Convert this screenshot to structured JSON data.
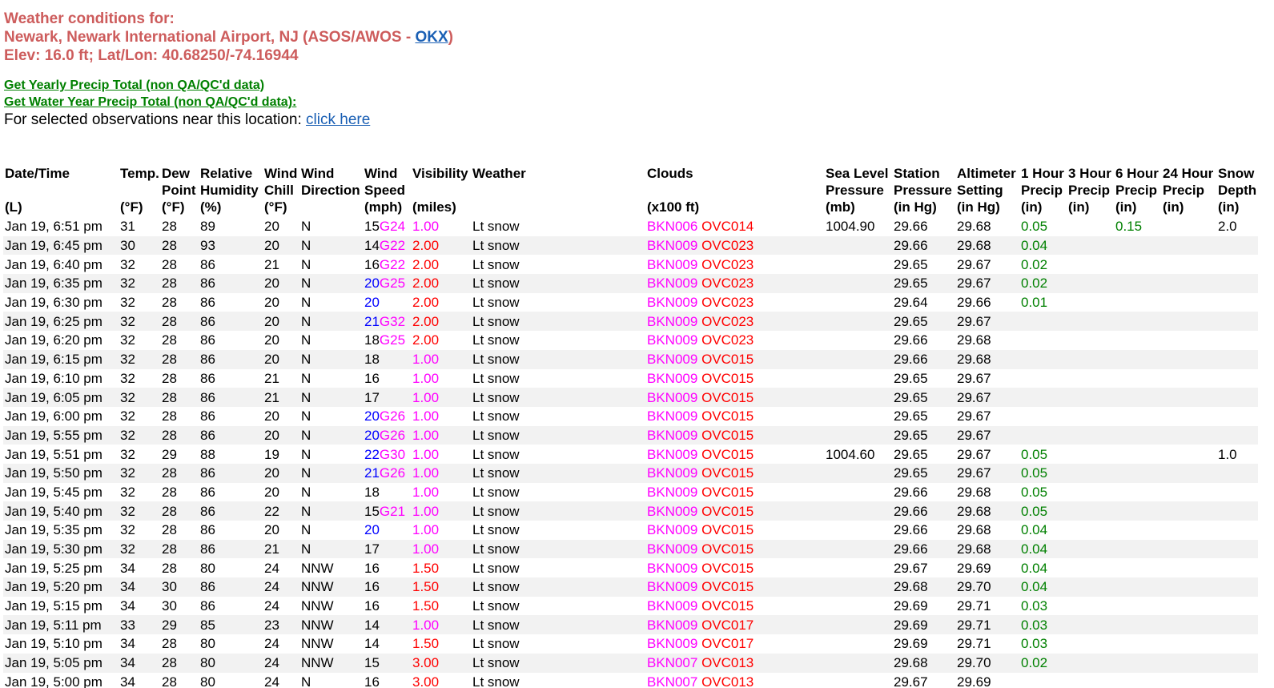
{
  "header": {
    "line1": "Weather conditions for:",
    "line2_prefix": "Newark, Newark International Airport, NJ (ASOS/AWOS - ",
    "line2_link": "OKX",
    "line2_suffix": ")",
    "line3": "Elev: 16.0 ft; Lat/Lon: 40.68250/-74.16944"
  },
  "links": {
    "yearly_precip": "Get Yearly Precip Total (non QA/QC'd data)",
    "water_year_precip": "Get Water Year Precip Total (non QA/QC'd data):",
    "selected_obs_text": "For selected observations near this location: ",
    "click_here": "click here"
  },
  "table": {
    "headers": {
      "datetime": [
        "Date/Time",
        "",
        "(L)"
      ],
      "temp": [
        "Temp.",
        "",
        "(°F)"
      ],
      "dew": [
        "Dew",
        "Point",
        "(°F)"
      ],
      "rh": [
        "Relative",
        "Humidity",
        "(%)"
      ],
      "chill": [
        "Wind",
        "Chill",
        "(°F)"
      ],
      "wdir": [
        "Wind",
        "Direction",
        ""
      ],
      "wspd": [
        "Wind",
        "Speed",
        "(mph)"
      ],
      "vis": [
        "Visibility",
        "",
        "(miles)"
      ],
      "wx": [
        "Weather",
        "",
        ""
      ],
      "clouds": [
        "Clouds",
        "",
        "(x100 ft)"
      ],
      "slp": [
        "Sea Level",
        "Pressure",
        "(mb)"
      ],
      "stp": [
        "Station",
        "Pressure",
        "(in Hg)"
      ],
      "alt": [
        "Altimeter",
        "Setting",
        "(in Hg)"
      ],
      "p1": [
        "1 Hour",
        "Precip",
        "(in)"
      ],
      "p3": [
        "3 Hour",
        "Precip",
        "(in)"
      ],
      "p6": [
        "6 Hour",
        "Precip",
        "(in)"
      ],
      "p24": [
        "24 Hour",
        "Precip",
        "(in)"
      ],
      "snow": [
        "Snow",
        "Depth",
        "(in)"
      ]
    },
    "rows": [
      {
        "dt": "Jan 19, 6:51 pm",
        "t": "31",
        "dp": "28",
        "rh": "89",
        "wc": "20",
        "wd": "N",
        "ws": "15",
        "wg": "G24",
        "wsblue": false,
        "vis": "1.00",
        "visc": "mag",
        "wx": "Lt snow",
        "bkn": "BKN006",
        "ovc": "OVC014",
        "slp": "1004.90",
        "stp": "29.66",
        "alt": "29.68",
        "p1": "0.05",
        "p3": "",
        "p6": "0.15",
        "p24": "",
        "sd": "2.0"
      },
      {
        "dt": "Jan 19, 6:45 pm",
        "t": "30",
        "dp": "28",
        "rh": "93",
        "wc": "20",
        "wd": "N",
        "ws": "14",
        "wg": "G22",
        "wsblue": false,
        "vis": "2.00",
        "visc": "red",
        "wx": "Lt snow",
        "bkn": "BKN009",
        "ovc": "OVC023",
        "slp": "",
        "stp": "29.66",
        "alt": "29.68",
        "p1": "0.04",
        "p3": "",
        "p6": "",
        "p24": "",
        "sd": ""
      },
      {
        "dt": "Jan 19, 6:40 pm",
        "t": "32",
        "dp": "28",
        "rh": "86",
        "wc": "21",
        "wd": "N",
        "ws": "16",
        "wg": "G22",
        "wsblue": false,
        "vis": "2.00",
        "visc": "red",
        "wx": "Lt snow",
        "bkn": "BKN009",
        "ovc": "OVC023",
        "slp": "",
        "stp": "29.65",
        "alt": "29.67",
        "p1": "0.02",
        "p3": "",
        "p6": "",
        "p24": "",
        "sd": ""
      },
      {
        "dt": "Jan 19, 6:35 pm",
        "t": "32",
        "dp": "28",
        "rh": "86",
        "wc": "20",
        "wd": "N",
        "ws": "20",
        "wg": "G25",
        "wsblue": true,
        "vis": "2.00",
        "visc": "red",
        "wx": "Lt snow",
        "bkn": "BKN009",
        "ovc": "OVC023",
        "slp": "",
        "stp": "29.65",
        "alt": "29.67",
        "p1": "0.02",
        "p3": "",
        "p6": "",
        "p24": "",
        "sd": ""
      },
      {
        "dt": "Jan 19, 6:30 pm",
        "t": "32",
        "dp": "28",
        "rh": "86",
        "wc": "20",
        "wd": "N",
        "ws": "20",
        "wg": "",
        "wsblue": true,
        "vis": "2.00",
        "visc": "red",
        "wx": "Lt snow",
        "bkn": "BKN009",
        "ovc": "OVC023",
        "slp": "",
        "stp": "29.64",
        "alt": "29.66",
        "p1": "0.01",
        "p3": "",
        "p6": "",
        "p24": "",
        "sd": ""
      },
      {
        "dt": "Jan 19, 6:25 pm",
        "t": "32",
        "dp": "28",
        "rh": "86",
        "wc": "20",
        "wd": "N",
        "ws": "21",
        "wg": "G32",
        "wsblue": true,
        "vis": "2.00",
        "visc": "red",
        "wx": "Lt snow",
        "bkn": "BKN009",
        "ovc": "OVC023",
        "slp": "",
        "stp": "29.65",
        "alt": "29.67",
        "p1": "",
        "p3": "",
        "p6": "",
        "p24": "",
        "sd": ""
      },
      {
        "dt": "Jan 19, 6:20 pm",
        "t": "32",
        "dp": "28",
        "rh": "86",
        "wc": "20",
        "wd": "N",
        "ws": "18",
        "wg": "G25",
        "wsblue": false,
        "vis": "2.00",
        "visc": "red",
        "wx": "Lt snow",
        "bkn": "BKN009",
        "ovc": "OVC023",
        "slp": "",
        "stp": "29.66",
        "alt": "29.68",
        "p1": "",
        "p3": "",
        "p6": "",
        "p24": "",
        "sd": ""
      },
      {
        "dt": "Jan 19, 6:15 pm",
        "t": "32",
        "dp": "28",
        "rh": "86",
        "wc": "20",
        "wd": "N",
        "ws": "18",
        "wg": "",
        "wsblue": false,
        "vis": "1.00",
        "visc": "mag",
        "wx": "Lt snow",
        "bkn": "BKN009",
        "ovc": "OVC015",
        "slp": "",
        "stp": "29.66",
        "alt": "29.68",
        "p1": "",
        "p3": "",
        "p6": "",
        "p24": "",
        "sd": ""
      },
      {
        "dt": "Jan 19, 6:10 pm",
        "t": "32",
        "dp": "28",
        "rh": "86",
        "wc": "21",
        "wd": "N",
        "ws": "16",
        "wg": "",
        "wsblue": false,
        "vis": "1.00",
        "visc": "mag",
        "wx": "Lt snow",
        "bkn": "BKN009",
        "ovc": "OVC015",
        "slp": "",
        "stp": "29.65",
        "alt": "29.67",
        "p1": "",
        "p3": "",
        "p6": "",
        "p24": "",
        "sd": ""
      },
      {
        "dt": "Jan 19, 6:05 pm",
        "t": "32",
        "dp": "28",
        "rh": "86",
        "wc": "21",
        "wd": "N",
        "ws": "17",
        "wg": "",
        "wsblue": false,
        "vis": "1.00",
        "visc": "mag",
        "wx": "Lt snow",
        "bkn": "BKN009",
        "ovc": "OVC015",
        "slp": "",
        "stp": "29.65",
        "alt": "29.67",
        "p1": "",
        "p3": "",
        "p6": "",
        "p24": "",
        "sd": ""
      },
      {
        "dt": "Jan 19, 6:00 pm",
        "t": "32",
        "dp": "28",
        "rh": "86",
        "wc": "20",
        "wd": "N",
        "ws": "20",
        "wg": "G26",
        "wsblue": true,
        "vis": "1.00",
        "visc": "mag",
        "wx": "Lt snow",
        "bkn": "BKN009",
        "ovc": "OVC015",
        "slp": "",
        "stp": "29.65",
        "alt": "29.67",
        "p1": "",
        "p3": "",
        "p6": "",
        "p24": "",
        "sd": ""
      },
      {
        "dt": "Jan 19, 5:55 pm",
        "t": "32",
        "dp": "28",
        "rh": "86",
        "wc": "20",
        "wd": "N",
        "ws": "20",
        "wg": "G26",
        "wsblue": true,
        "vis": "1.00",
        "visc": "mag",
        "wx": "Lt snow",
        "bkn": "BKN009",
        "ovc": "OVC015",
        "slp": "",
        "stp": "29.65",
        "alt": "29.67",
        "p1": "",
        "p3": "",
        "p6": "",
        "p24": "",
        "sd": ""
      },
      {
        "dt": "Jan 19, 5:51 pm",
        "t": "32",
        "dp": "29",
        "rh": "88",
        "wc": "19",
        "wd": "N",
        "ws": "22",
        "wg": "G30",
        "wsblue": true,
        "vis": "1.00",
        "visc": "mag",
        "wx": "Lt snow",
        "bkn": "BKN009",
        "ovc": "OVC015",
        "slp": "1004.60",
        "stp": "29.65",
        "alt": "29.67",
        "p1": "0.05",
        "p3": "",
        "p6": "",
        "p24": "",
        "sd": "1.0"
      },
      {
        "dt": "Jan 19, 5:50 pm",
        "t": "32",
        "dp": "28",
        "rh": "86",
        "wc": "20",
        "wd": "N",
        "ws": "21",
        "wg": "G26",
        "wsblue": true,
        "vis": "1.00",
        "visc": "mag",
        "wx": "Lt snow",
        "bkn": "BKN009",
        "ovc": "OVC015",
        "slp": "",
        "stp": "29.65",
        "alt": "29.67",
        "p1": "0.05",
        "p3": "",
        "p6": "",
        "p24": "",
        "sd": ""
      },
      {
        "dt": "Jan 19, 5:45 pm",
        "t": "32",
        "dp": "28",
        "rh": "86",
        "wc": "20",
        "wd": "N",
        "ws": "18",
        "wg": "",
        "wsblue": false,
        "vis": "1.00",
        "visc": "mag",
        "wx": "Lt snow",
        "bkn": "BKN009",
        "ovc": "OVC015",
        "slp": "",
        "stp": "29.66",
        "alt": "29.68",
        "p1": "0.05",
        "p3": "",
        "p6": "",
        "p24": "",
        "sd": ""
      },
      {
        "dt": "Jan 19, 5:40 pm",
        "t": "32",
        "dp": "28",
        "rh": "86",
        "wc": "22",
        "wd": "N",
        "ws": "15",
        "wg": "G21",
        "wsblue": false,
        "vis": "1.00",
        "visc": "mag",
        "wx": "Lt snow",
        "bkn": "BKN009",
        "ovc": "OVC015",
        "slp": "",
        "stp": "29.66",
        "alt": "29.68",
        "p1": "0.05",
        "p3": "",
        "p6": "",
        "p24": "",
        "sd": ""
      },
      {
        "dt": "Jan 19, 5:35 pm",
        "t": "32",
        "dp": "28",
        "rh": "86",
        "wc": "20",
        "wd": "N",
        "ws": "20",
        "wg": "",
        "wsblue": true,
        "vis": "1.00",
        "visc": "mag",
        "wx": "Lt snow",
        "bkn": "BKN009",
        "ovc": "OVC015",
        "slp": "",
        "stp": "29.66",
        "alt": "29.68",
        "p1": "0.04",
        "p3": "",
        "p6": "",
        "p24": "",
        "sd": ""
      },
      {
        "dt": "Jan 19, 5:30 pm",
        "t": "32",
        "dp": "28",
        "rh": "86",
        "wc": "21",
        "wd": "N",
        "ws": "17",
        "wg": "",
        "wsblue": false,
        "vis": "1.00",
        "visc": "mag",
        "wx": "Lt snow",
        "bkn": "BKN009",
        "ovc": "OVC015",
        "slp": "",
        "stp": "29.66",
        "alt": "29.68",
        "p1": "0.04",
        "p3": "",
        "p6": "",
        "p24": "",
        "sd": ""
      },
      {
        "dt": "Jan 19, 5:25 pm",
        "t": "34",
        "dp": "28",
        "rh": "80",
        "wc": "24",
        "wd": "NNW",
        "ws": "16",
        "wg": "",
        "wsblue": false,
        "vis": "1.50",
        "visc": "red",
        "wx": "Lt snow",
        "bkn": "BKN009",
        "ovc": "OVC015",
        "slp": "",
        "stp": "29.67",
        "alt": "29.69",
        "p1": "0.04",
        "p3": "",
        "p6": "",
        "p24": "",
        "sd": ""
      },
      {
        "dt": "Jan 19, 5:20 pm",
        "t": "34",
        "dp": "30",
        "rh": "86",
        "wc": "24",
        "wd": "NNW",
        "ws": "16",
        "wg": "",
        "wsblue": false,
        "vis": "1.50",
        "visc": "red",
        "wx": "Lt snow",
        "bkn": "BKN009",
        "ovc": "OVC015",
        "slp": "",
        "stp": "29.68",
        "alt": "29.70",
        "p1": "0.04",
        "p3": "",
        "p6": "",
        "p24": "",
        "sd": ""
      },
      {
        "dt": "Jan 19, 5:15 pm",
        "t": "34",
        "dp": "30",
        "rh": "86",
        "wc": "24",
        "wd": "NNW",
        "ws": "16",
        "wg": "",
        "wsblue": false,
        "vis": "1.50",
        "visc": "red",
        "wx": "Lt snow",
        "bkn": "BKN009",
        "ovc": "OVC015",
        "slp": "",
        "stp": "29.69",
        "alt": "29.71",
        "p1": "0.03",
        "p3": "",
        "p6": "",
        "p24": "",
        "sd": ""
      },
      {
        "dt": "Jan 19, 5:11 pm",
        "t": "33",
        "dp": "29",
        "rh": "85",
        "wc": "23",
        "wd": "NNW",
        "ws": "14",
        "wg": "",
        "wsblue": false,
        "vis": "1.00",
        "visc": "mag",
        "wx": "Lt snow",
        "bkn": "BKN009",
        "ovc": "OVC017",
        "slp": "",
        "stp": "29.69",
        "alt": "29.71",
        "p1": "0.03",
        "p3": "",
        "p6": "",
        "p24": "",
        "sd": ""
      },
      {
        "dt": "Jan 19, 5:10 pm",
        "t": "34",
        "dp": "28",
        "rh": "80",
        "wc": "24",
        "wd": "NNW",
        "ws": "14",
        "wg": "",
        "wsblue": false,
        "vis": "1.50",
        "visc": "red",
        "wx": "Lt snow",
        "bkn": "BKN009",
        "ovc": "OVC017",
        "slp": "",
        "stp": "29.69",
        "alt": "29.71",
        "p1": "0.03",
        "p3": "",
        "p6": "",
        "p24": "",
        "sd": ""
      },
      {
        "dt": "Jan 19, 5:05 pm",
        "t": "34",
        "dp": "28",
        "rh": "80",
        "wc": "24",
        "wd": "NNW",
        "ws": "15",
        "wg": "",
        "wsblue": false,
        "vis": "3.00",
        "visc": "red",
        "wx": "Lt snow",
        "bkn": "BKN007",
        "ovc": "OVC013",
        "slp": "",
        "stp": "29.68",
        "alt": "29.70",
        "p1": "0.02",
        "p3": "",
        "p6": "",
        "p24": "",
        "sd": ""
      },
      {
        "dt": "Jan 19, 5:00 pm",
        "t": "34",
        "dp": "28",
        "rh": "80",
        "wc": "24",
        "wd": "N",
        "ws": "16",
        "wg": "",
        "wsblue": false,
        "vis": "3.00",
        "visc": "red",
        "wx": "Lt snow",
        "bkn": "BKN007",
        "ovc": "OVC013",
        "slp": "",
        "stp": "29.67",
        "alt": "29.69",
        "p1": "",
        "p3": "",
        "p6": "",
        "p24": "",
        "sd": ""
      }
    ]
  }
}
